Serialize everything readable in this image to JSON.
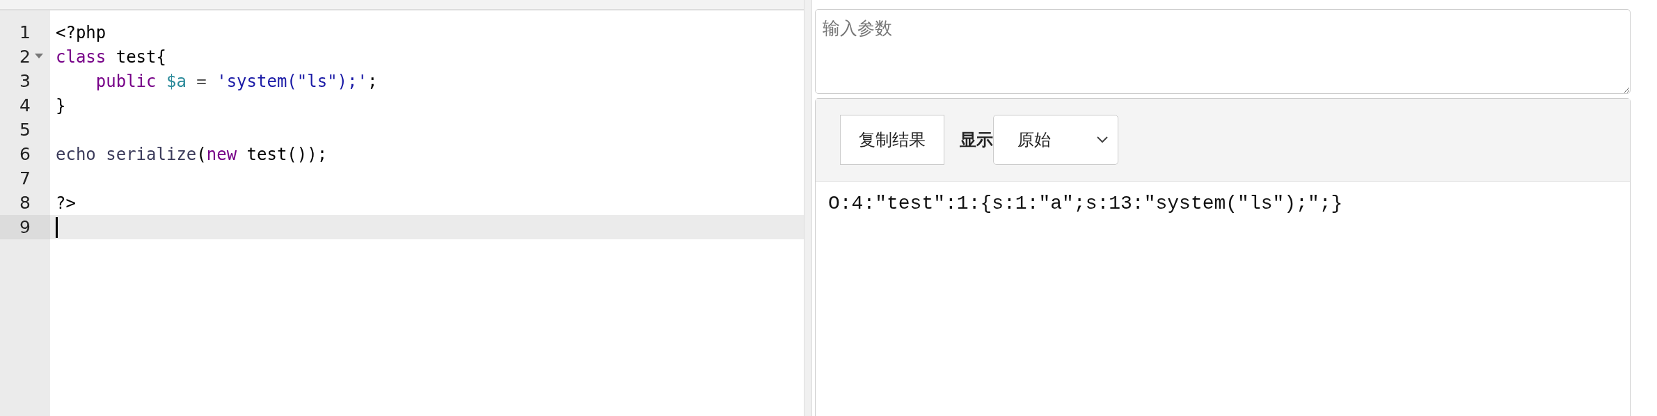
{
  "editor": {
    "lines": [
      {
        "number": "1",
        "active": false,
        "foldable": false,
        "tokens": [
          {
            "text": "<?php",
            "kind": "plain"
          }
        ]
      },
      {
        "number": "2",
        "active": false,
        "foldable": true,
        "tokens": [
          {
            "text": "class",
            "kind": "keyword"
          },
          {
            "text": " test{",
            "kind": "plain"
          }
        ]
      },
      {
        "number": "3",
        "active": false,
        "foldable": false,
        "tokens": [
          {
            "text": "    public",
            "kind": "keyword"
          },
          {
            "text": " $a",
            "kind": "variable"
          },
          {
            "text": " = ",
            "kind": "operator"
          },
          {
            "text": "'system(\"ls\");'",
            "kind": "string"
          },
          {
            "text": ";",
            "kind": "plain"
          }
        ]
      },
      {
        "number": "4",
        "active": false,
        "foldable": false,
        "tokens": [
          {
            "text": "}",
            "kind": "plain"
          }
        ]
      },
      {
        "number": "5",
        "active": false,
        "foldable": false
      },
      {
        "number": "6",
        "active": false,
        "foldable": false,
        "tokens": [
          {
            "text": "echo serialize",
            "kind": "builtin"
          },
          {
            "text": "(",
            "kind": "plain"
          },
          {
            "text": "new",
            "kind": "keyword"
          },
          {
            "text": " test());",
            "kind": "plain"
          }
        ]
      },
      {
        "number": "7",
        "active": false,
        "foldable": false
      },
      {
        "number": "8",
        "active": false,
        "foldable": false,
        "tokens": [
          {
            "text": "?>",
            "kind": "plain"
          }
        ]
      },
      {
        "number": "9",
        "active": true,
        "foldable": false
      }
    ]
  },
  "params": {
    "placeholder": "输入参数"
  },
  "result": {
    "copy_button": "复制结果",
    "display_label": "显示",
    "display_select": "原始",
    "output": "O:4:\"test\":1:{s:1:\"a\";s:13:\"system(\"ls\");\";}"
  }
}
